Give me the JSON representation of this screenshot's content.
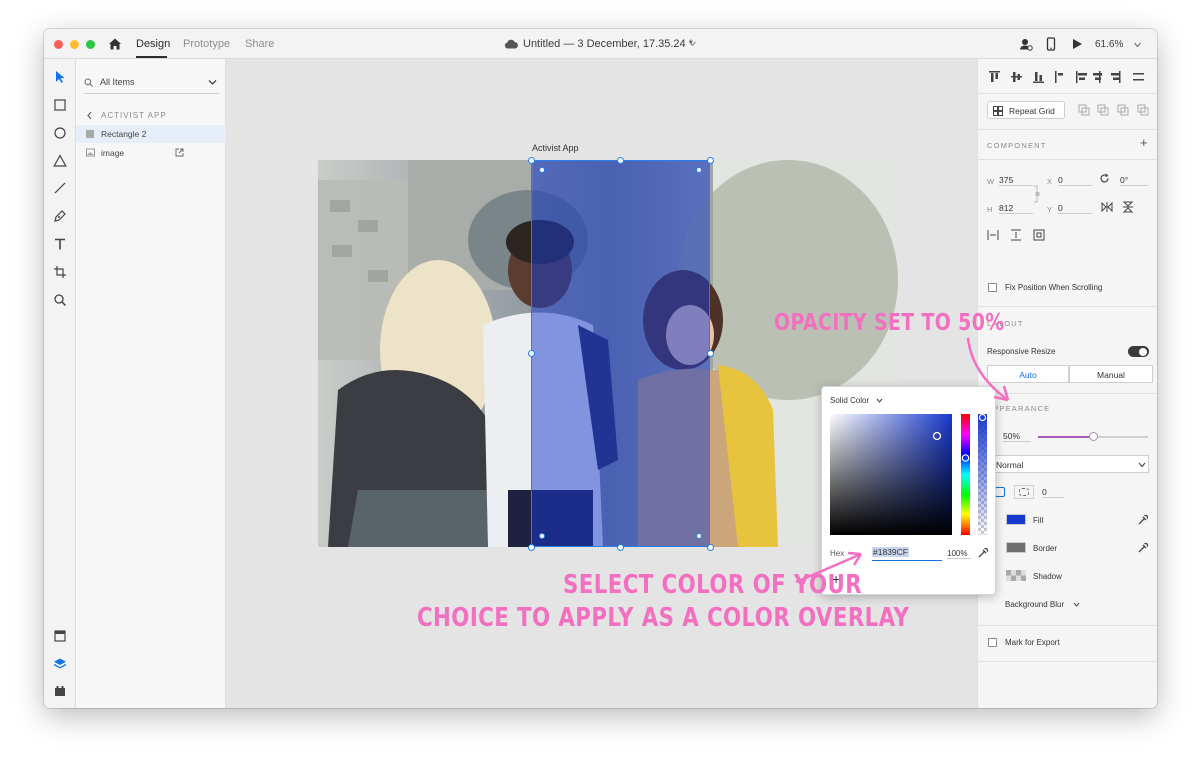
{
  "window": {
    "tabs": [
      {
        "label": "Design",
        "active": true
      },
      {
        "label": "Prototype",
        "active": false
      },
      {
        "label": "Share",
        "active": false
      }
    ],
    "doc_title": "Untitled — 3 December, 17.35.24 *",
    "zoom": "61.6%"
  },
  "layers": {
    "filter": "All Items",
    "breadcrumb": "ACTIVIST APP",
    "items": [
      {
        "label": "Rectangle 2",
        "selected": true
      },
      {
        "label": "image",
        "selected": false
      }
    ]
  },
  "canvas": {
    "artboard_label": "Activist App",
    "overlay_color": "#1839CF",
    "overlay_opacity": 0.5
  },
  "props": {
    "repeat_grid": "Repeat Grid",
    "component_title": "COMPONENT",
    "w_label": "W",
    "w_value": "375",
    "h_label": "H",
    "h_value": "812",
    "x_label": "X",
    "x_value": "0",
    "y_label": "Y",
    "y_value": "0",
    "rotation": "0°",
    "fix_position": "Fix Position When Scrolling",
    "layout_title": "LAYOUT",
    "responsive_resize": "Responsive Resize",
    "seg_auto": "Auto",
    "seg_manual": "Manual",
    "appearance_title": "APPEARANCE",
    "opacity_value": "50%",
    "blend_mode": "Normal",
    "corner_value": "0",
    "fill_label": "Fill",
    "border_label": "Border",
    "shadow_label": "Shadow",
    "bg_blur_label": "Background Blur",
    "mark_export": "Mark for Export",
    "colors": {
      "fill": "#1839CF",
      "border": "#6e6e6e",
      "accent_slider": "#a55ab5",
      "toggle": "#3b3b3b"
    }
  },
  "picker": {
    "mode": "Solid Color",
    "hex_label": "Hex",
    "hex_value": "#1839CF",
    "alpha_value": "100%",
    "add_symbol": "+"
  },
  "annotations": {
    "opacity_note": "OPACITY SET TO 50%",
    "color_note_line1": "SELECT COLOR OF YOUR",
    "color_note_line2": "CHOICE TO APPLY AS A COLOR OVERLAY",
    "color": "#f36fc0"
  }
}
